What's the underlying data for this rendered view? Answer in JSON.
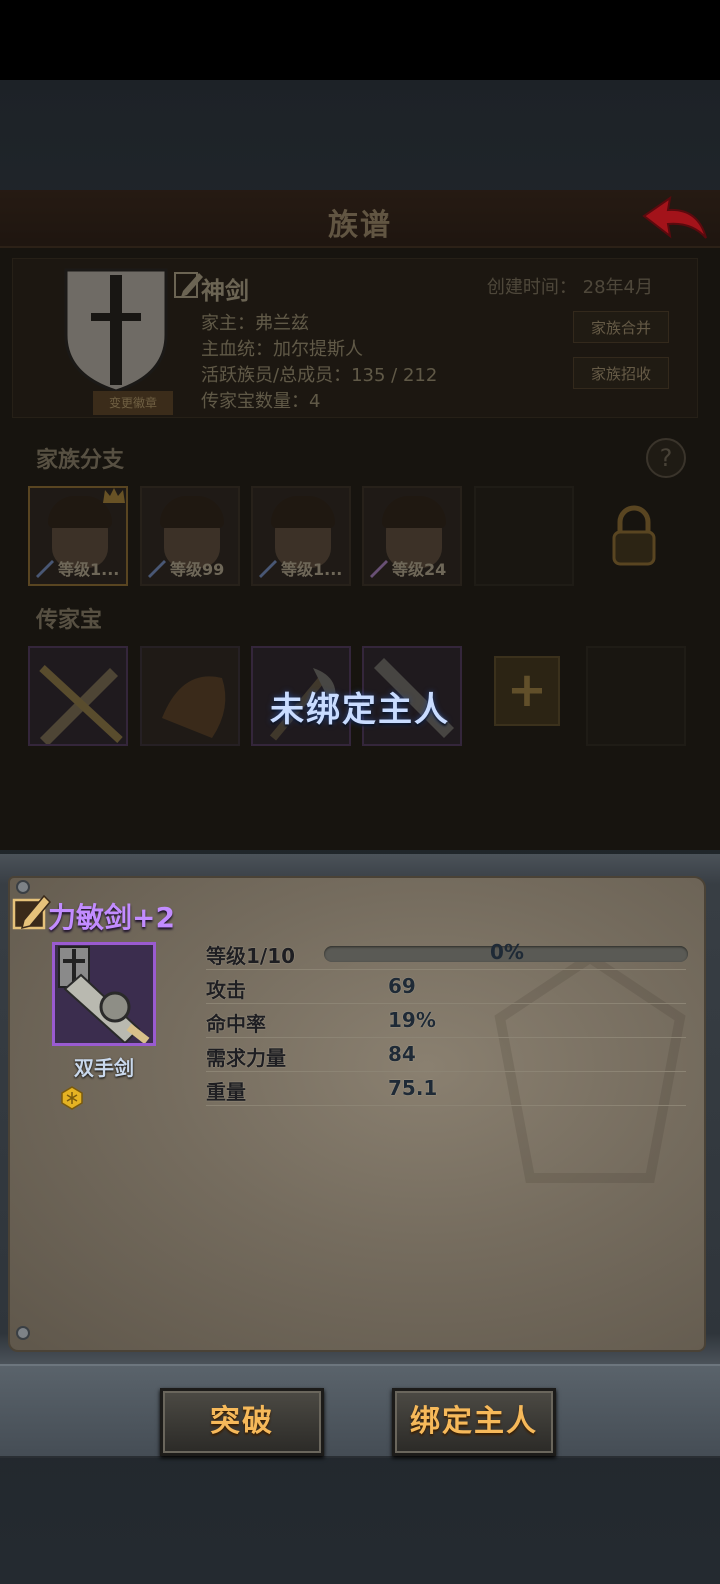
{
  "colors": {
    "item_rarity": "#c28cff",
    "button_text": "#f6b95a",
    "unbound_text": "#c9dcff"
  },
  "family": {
    "title": "族谱",
    "name": "神剑",
    "created_label": "创建时间：",
    "created_value": "28年4月",
    "leader_label": "家主：",
    "leader_value": "弗兰兹",
    "bloodline_label": "主血统：",
    "bloodline_value": "加尔提斯人",
    "members_label": "活跃族员/总成员：",
    "members_value": "135 / 212",
    "heirloom_count_label": "传家宝数量：",
    "heirloom_count_value": "4",
    "crest_button": "变更徽章",
    "merge_button": "家族合并",
    "recruit_button": "家族招收",
    "branches_title": "家族分支",
    "heirlooms_title": "传家宝",
    "help": "?",
    "branches": [
      {
        "level": "等级1..."
      },
      {
        "level": "等级99"
      },
      {
        "level": "等级1..."
      },
      {
        "level": "等级24"
      }
    ],
    "add": "+"
  },
  "overlay": {
    "unbound": "未绑定主人"
  },
  "item": {
    "name": "力敏剑+2",
    "type": "双手剑",
    "stats": [
      {
        "label": "等级1/10",
        "value": "0%",
        "progress": 0
      },
      {
        "label": "攻击",
        "value": "69"
      },
      {
        "label": "命中率",
        "value": "19%"
      },
      {
        "label": "需求力量",
        "value": "84"
      },
      {
        "label": "重量",
        "value": "75.1"
      }
    ]
  },
  "actions": {
    "breakthrough": "突破",
    "bind_owner": "绑定主人"
  }
}
